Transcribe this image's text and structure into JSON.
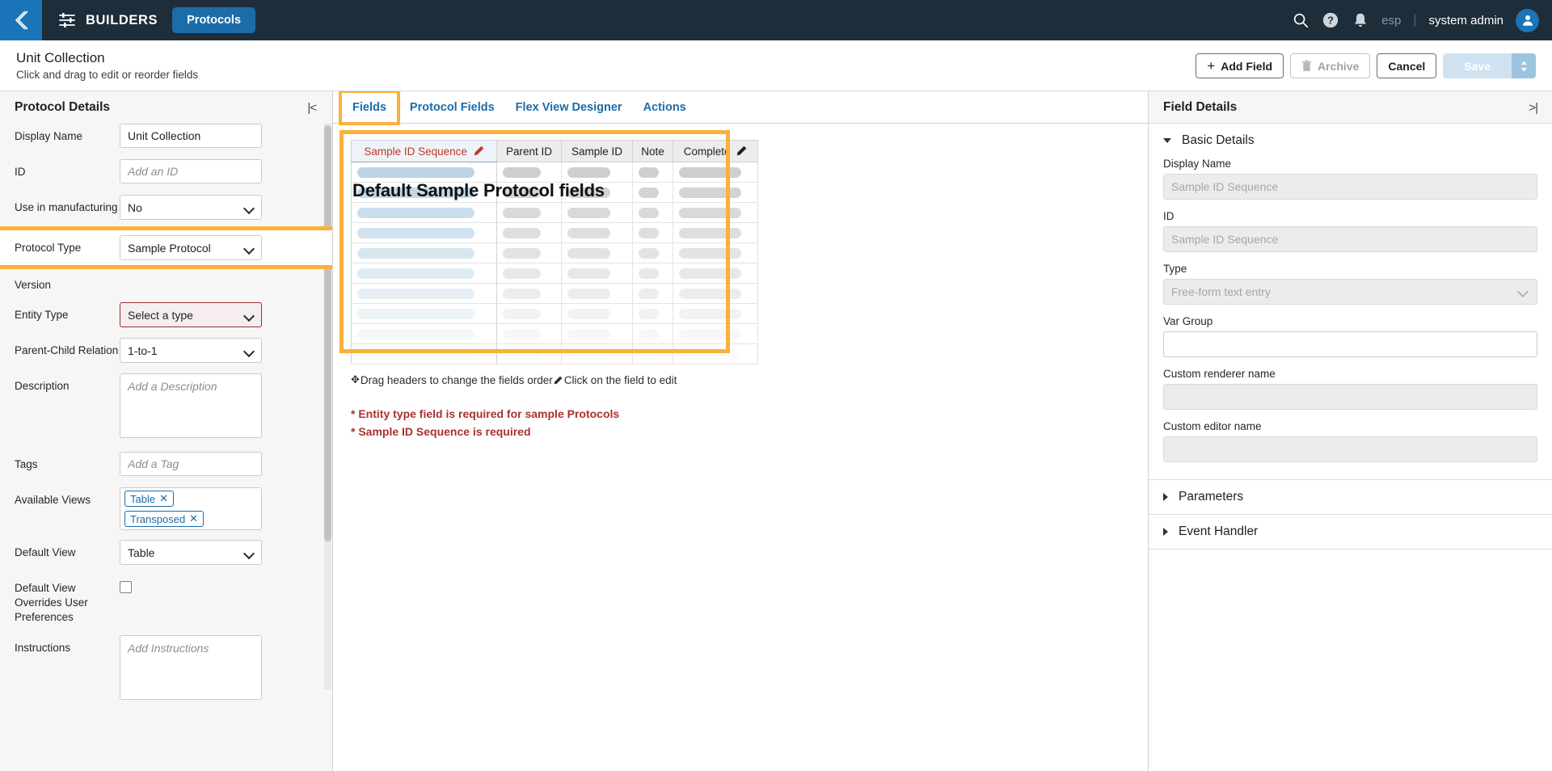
{
  "topnav": {
    "back_icon": "chevron-left-icon",
    "builders_icon": "sliders-icon",
    "builders_label": "BUILDERS",
    "protocols_label": "Protocols",
    "search_icon": "search-icon",
    "help_icon": "help-circle-icon",
    "bell_icon": "bell-icon",
    "locale_label": "esp",
    "separator": "|",
    "user_label": "system admin",
    "avatar_icon": "user-avatar-icon"
  },
  "subheader": {
    "title": "Unit Collection",
    "subtitle": "Click and drag to edit or reorder fields",
    "add_field_label": "Add Field",
    "add_field_icon": "plus-icon",
    "archive_label": "Archive",
    "archive_icon": "trash-icon",
    "cancel_label": "Cancel",
    "save_label": "Save",
    "save_caret_icon": "chevron-updown-icon"
  },
  "left_panel": {
    "title": "Protocol Details",
    "collapse_icon": "collapse-left-icon",
    "display_name": {
      "label": "Display Name",
      "value": "Unit Collection"
    },
    "id": {
      "label": "ID",
      "placeholder": "Add an ID",
      "value": ""
    },
    "use_in_manufacturing": {
      "label": "Use in manufacturing",
      "value": "No"
    },
    "protocol_type": {
      "label": "Protocol Type",
      "value": "Sample Protocol"
    },
    "version": {
      "label": "Version",
      "value": ""
    },
    "entity_type": {
      "label": "Entity Type",
      "value": "Select a type"
    },
    "parent_child_relation": {
      "label": "Parent-Child Relation",
      "value": "1-to-1"
    },
    "description": {
      "label": "Description",
      "placeholder": "Add a Description",
      "value": ""
    },
    "tags": {
      "label": "Tags",
      "placeholder": "Add a Tag",
      "value": ""
    },
    "available_views": {
      "label": "Available Views",
      "chips": [
        "Table",
        "Transposed"
      ],
      "chip_remove_icon": "close-icon"
    },
    "default_view": {
      "label": "Default View",
      "value": "Table"
    },
    "default_view_overrides": {
      "label": "Default View Overrides User Preferences",
      "checked": false
    },
    "instructions": {
      "label": "Instructions",
      "placeholder": "Add Instructions",
      "value": ""
    }
  },
  "tabs": [
    {
      "label": "Fields",
      "active": true
    },
    {
      "label": "Protocol Fields",
      "active": false
    },
    {
      "label": "Flex View Designer",
      "active": false
    },
    {
      "label": "Actions",
      "active": false
    }
  ],
  "field_table": {
    "columns": [
      {
        "label": "Sample ID Sequence",
        "required": true,
        "editable": true,
        "edit_icon": "pencil-icon"
      },
      {
        "label": "Parent ID",
        "required": false,
        "editable": false
      },
      {
        "label": "Sample ID",
        "required": false,
        "editable": false
      },
      {
        "label": "Note",
        "required": false,
        "editable": false
      },
      {
        "label": "Complete",
        "required": false,
        "editable": true,
        "edit_icon": "pencil-icon"
      }
    ],
    "row_count": 10,
    "overlay_annotation": "Default Sample Protocol fields",
    "hint_move_icon": "move-icon",
    "hint_drag": "Drag headers to change the fields order",
    "hint_pencil_icon": "pencil-icon",
    "hint_click": "Click on the field to edit",
    "errors": [
      "* Entity type field is required for sample Protocols",
      "* Sample ID Sequence is required"
    ]
  },
  "right_panel": {
    "title": "Field Details",
    "collapse_icon": "collapse-right-icon",
    "basic_details": {
      "label": "Basic Details",
      "expanded": true,
      "display_name": {
        "label": "Display Name",
        "placeholder": "Sample ID Sequence",
        "value": ""
      },
      "id": {
        "label": "ID",
        "placeholder": "Sample ID Sequence",
        "value": ""
      },
      "type": {
        "label": "Type",
        "placeholder": "Free-form text entry",
        "value": ""
      },
      "var_group": {
        "label": "Var Group",
        "placeholder": "",
        "value": ""
      },
      "custom_renderer": {
        "label": "Custom renderer name",
        "placeholder": "",
        "value": ""
      },
      "custom_editor": {
        "label": "Custom editor name",
        "placeholder": "",
        "value": ""
      }
    },
    "parameters": {
      "label": "Parameters",
      "expanded": false
    },
    "event_handler": {
      "label": "Event Handler",
      "expanded": false
    }
  },
  "colors": {
    "nav_bg": "#1d2d3a",
    "accent_blue": "#1b6ca8",
    "highlight_orange": "#fbb03b",
    "error_red": "#a8322d",
    "required_red": "#c0392b"
  }
}
